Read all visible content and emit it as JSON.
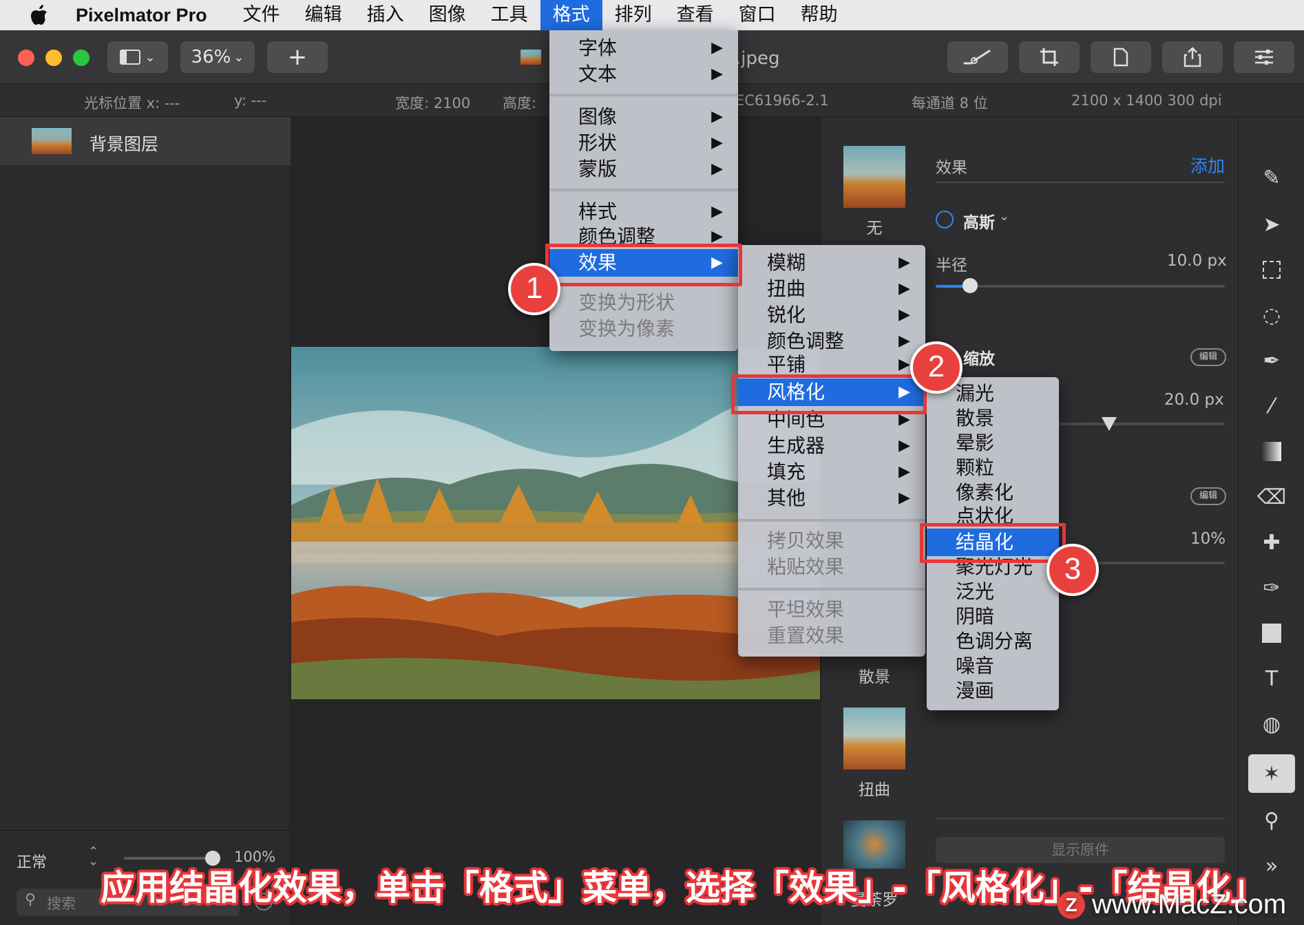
{
  "menubar": {
    "app_name": "Pixelmator Pro",
    "items": [
      "文件",
      "编辑",
      "插入",
      "图像",
      "工具",
      "格式",
      "排列",
      "查看",
      "窗口",
      "帮助"
    ],
    "active_index": 5
  },
  "toolbar": {
    "zoom": "36%",
    "add_label": "+",
    "doc_title": ".jpeg"
  },
  "infobar": {
    "cursor_x": "光标位置 x:  ---",
    "cursor_y": "y:  ---",
    "width": "宽度:  2100",
    "height": "高度:",
    "profile": "EC61966-2.1",
    "depth": "每通道 8 位",
    "size": "2100 x 1400 300 dpi"
  },
  "layers": {
    "layer_name": "背景图层",
    "blend_mode": "正常",
    "opacity": "100%",
    "search_placeholder": "搜索"
  },
  "effects_panel": {
    "header": "效果",
    "add_label": "添加",
    "effect_name": "高斯",
    "radius_label": "半径",
    "radius_value": "10.0 px",
    "radius_fraction": 0.12,
    "zoom_label": "缩放",
    "edit_badge": "编辑",
    "value_2": "20.0 px",
    "value_2_fraction": 0.6,
    "value_3": "10%",
    "presets": [
      "无",
      "散景",
      "扭曲",
      "曼荼罗"
    ],
    "show_original": "显示原件"
  },
  "format_menu": {
    "items": [
      "字体",
      "文本",
      "图像",
      "形状",
      "蒙版",
      "样式",
      "颜色调整",
      "效果",
      "变换为形状",
      "变换为像素"
    ]
  },
  "effects_submenu": {
    "items": [
      "模糊",
      "扭曲",
      "锐化",
      "颜色调整",
      "平铺",
      "风格化",
      "中间色",
      "生成器",
      "填充",
      "其他",
      "拷贝效果",
      "粘贴效果",
      "平坦效果",
      "重置效果"
    ]
  },
  "stylize_submenu": {
    "items": [
      "漏光",
      "散景",
      "晕影",
      "颗粒",
      "像素化",
      "点状化",
      "结晶化",
      "聚光灯光",
      "泛光",
      "阴暗",
      "色调分离",
      "噪音",
      "漫画"
    ]
  },
  "steps": [
    "1",
    "2",
    "3"
  ],
  "caption": "应用结晶化效果，单击「格式」菜单，选择「效果」-「风格化」-「结晶化」",
  "watermark": {
    "logo": "Z",
    "text": "www.MacZ.com"
  },
  "colors": {
    "accent": "#1f6ce0",
    "highlight_red": "#e8363a"
  }
}
